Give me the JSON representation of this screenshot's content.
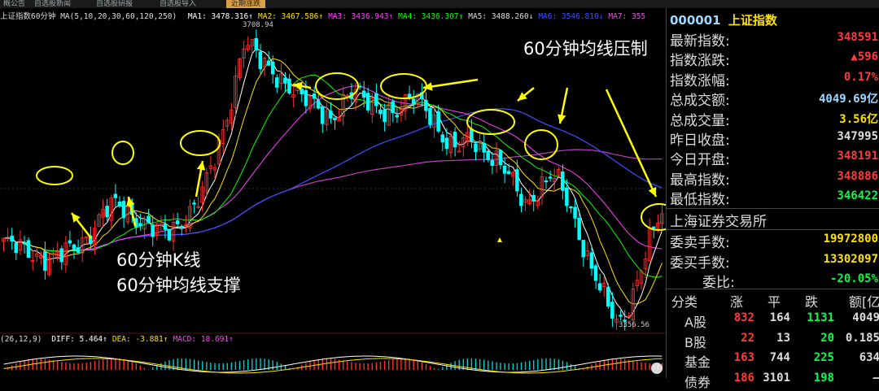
{
  "toolbar": {
    "tabs": [
      {
        "label": "概公告",
        "active": false
      },
      {
        "label": "自选股新闻",
        "active": false
      },
      {
        "label": "自选股研报",
        "active": false
      },
      {
        "label": "自选股导入",
        "active": false
      },
      {
        "label": "近期涨跌",
        "active": true
      }
    ]
  },
  "chart": {
    "legend": {
      "name": "上证指数60分钟",
      "ma_params": "MA(5,10,20,30,60,120,250)",
      "ma_items": [
        {
          "label": "MA1: 3478.316↑",
          "color": "#ffffff"
        },
        {
          "label": "MA2: 3467.586↑",
          "color": "#ffe100"
        },
        {
          "label": "MA3: 3436.943↑",
          "color": "#ff40ff"
        },
        {
          "label": "MA4: 3436.307↑",
          "color": "#00ff00"
        },
        {
          "label": "MA5: 3488.260↓",
          "color": "#dddddd"
        },
        {
          "label": "MA6: 3546.810↓",
          "color": "#3c50ff"
        },
        {
          "label": "MA7: 355",
          "color": "#d060d0"
        }
      ]
    },
    "high_label": "3708.94",
    "low_label": "3356.56",
    "macd_legend": {
      "params": "(26,12,9)",
      "items": [
        {
          "label": "DIFF: 5.464↑",
          "color": "#ffffff"
        },
        {
          "label": "DEA: -3.881↑",
          "color": "#ffe100"
        },
        {
          "label": "MACD: 18.691↑",
          "color": "#ff40ff"
        }
      ]
    },
    "annotations": {
      "top_right": "60分钟均线压制",
      "bottom_line1": "60分钟K线",
      "bottom_line2": "60分钟均线支撑"
    },
    "colors": {
      "up": "#ff3030",
      "down": "#00ffff",
      "highlight": "#ffff00"
    }
  },
  "chart_data": {
    "type": "candlestick",
    "title": "上证指数60分钟",
    "close_path": [
      3458,
      3452,
      3448,
      3445,
      3442,
      3440,
      3438,
      3442,
      3448,
      3456,
      3468,
      3485,
      3496,
      3500,
      3495,
      3490,
      3486,
      3478,
      3470,
      3465,
      3472,
      3486,
      3500,
      3515,
      3535,
      3560,
      3600,
      3645,
      3700,
      3690,
      3670,
      3660,
      3655,
      3650,
      3640,
      3628,
      3620,
      3612,
      3605,
      3615,
      3630,
      3635,
      3625,
      3622,
      3618,
      3615,
      3612,
      3618,
      3628,
      3624,
      3612,
      3590,
      3570,
      3565,
      3578,
      3582,
      3570,
      3560,
      3548,
      3535,
      3520,
      3505,
      3515,
      3525,
      3535,
      3526,
      3505,
      3480,
      3448,
      3420,
      3395,
      3372,
      3360,
      3380,
      3410,
      3440,
      3470,
      3490
    ],
    "high": 3708.94,
    "low": 3356.56
  },
  "info": {
    "code": "000001",
    "name": "上证指数",
    "stats": [
      {
        "label": "最新指数:",
        "value": "348591",
        "color": "#ff3a3a"
      },
      {
        "label": "指数涨跌:",
        "value": "▲596",
        "color": "#ff3a3a"
      },
      {
        "label": "指数涨幅:",
        "value": "0.17%",
        "color": "#ff3a3a"
      },
      {
        "label": "总成交额:",
        "value": "4049.69亿",
        "color": "#9fd8ff"
      },
      {
        "label": "总成交量:",
        "value": "3.56亿",
        "color": "#ffe100"
      },
      {
        "label": "昨日收盘:",
        "value": "347995",
        "color": "#dddddd"
      },
      {
        "label": "今日开盘:",
        "value": "348191",
        "color": "#ff3a3a"
      },
      {
        "label": "最高指数:",
        "value": "348886",
        "color": "#ff3a3a"
      },
      {
        "label": "最低指数:",
        "value": "346422",
        "color": "#00ff44"
      }
    ],
    "exchange": "上海证券交易所",
    "orders": [
      {
        "label": "委卖手数:",
        "value": "19972800",
        "color": "#ffe100"
      },
      {
        "label": "委买手数:",
        "value": "13302097",
        "color": "#ffe100"
      },
      {
        "label": "委比:",
        "value": "-20.05%",
        "color": "#00ff44"
      }
    ],
    "table": {
      "headers": [
        "分类",
        "涨",
        "平",
        "跌",
        "额[亿"
      ],
      "rows": [
        {
          "cat": "A股",
          "up": "832",
          "flat": "164",
          "down": "1131",
          "amt": "4049"
        },
        {
          "cat": "B股",
          "up": "22",
          "flat": "13",
          "down": "20",
          "amt": "0.185"
        },
        {
          "cat": "基金",
          "up": "163",
          "flat": "744",
          "down": "225",
          "amt": "634"
        },
        {
          "cat": "债券",
          "up": "186",
          "flat": "3101",
          "down": "198",
          "amt": "—"
        }
      ]
    }
  }
}
